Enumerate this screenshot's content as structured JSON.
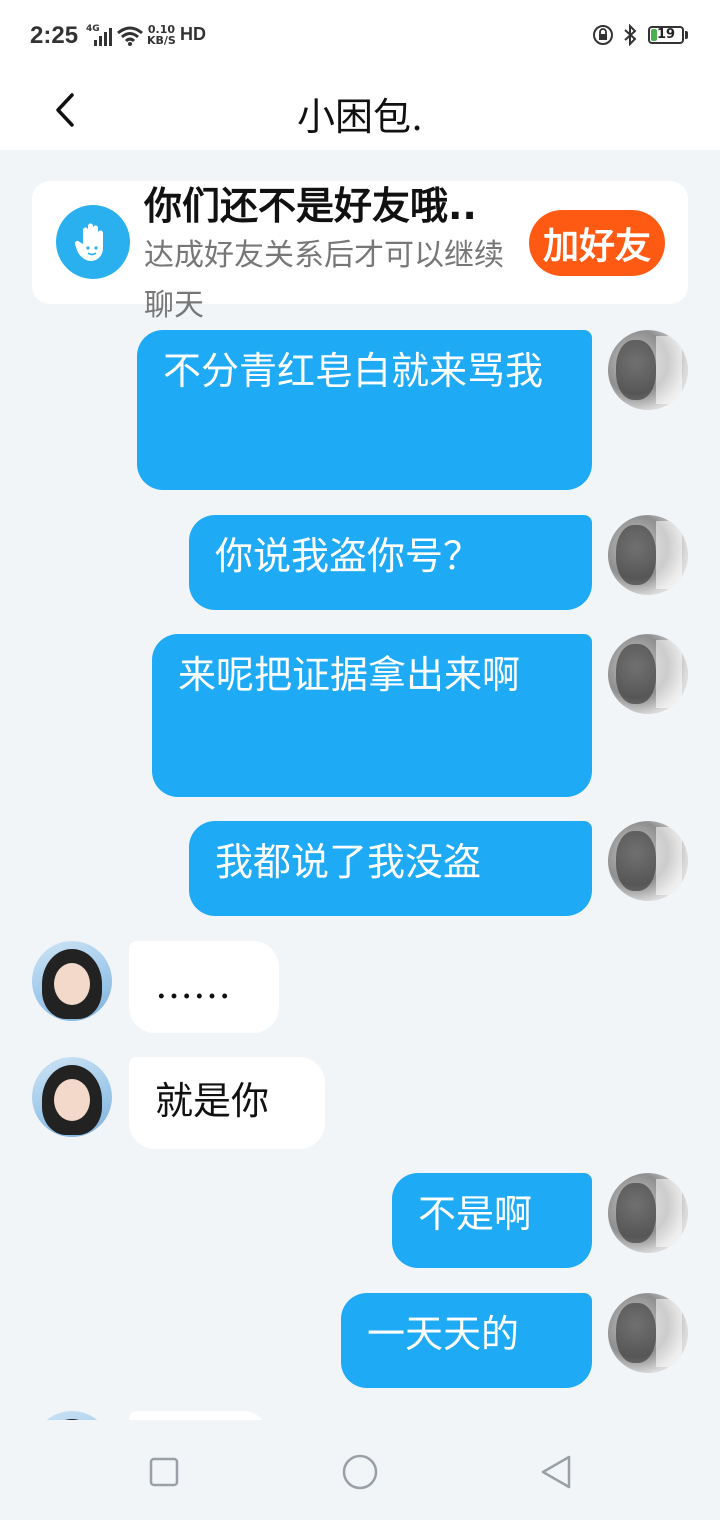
{
  "status": {
    "time": "2:25",
    "network": "4G",
    "speed_value": "0.10",
    "speed_unit": "KB/S",
    "hd": "HD",
    "battery": "19"
  },
  "header": {
    "title": "小困包."
  },
  "banner": {
    "title": "你们还不是好友哦..",
    "subtitle": "达成好友关系后才可以继续聊天",
    "add_button": "加好友"
  },
  "messages": [
    {
      "side": "out",
      "text": "不分青红皂白就来骂我"
    },
    {
      "side": "out",
      "text": "你说我盗你号？"
    },
    {
      "side": "out",
      "text": "来呢把证据拿出来啊"
    },
    {
      "side": "out",
      "text": "我都说了我没盗"
    },
    {
      "side": "in",
      "text": "……"
    },
    {
      "side": "in",
      "text": "就是你"
    },
    {
      "side": "out",
      "text": "不是啊"
    },
    {
      "side": "out",
      "text": "一天天的"
    }
  ],
  "icons": {
    "back": "chevron-left-icon",
    "banner": "hand-wave-icon",
    "nav_recent": "square-icon",
    "nav_home": "circle-icon",
    "nav_back": "triangle-back-icon"
  },
  "colors": {
    "bubble_out": "#1eaaf5",
    "bubble_in": "#ffffff",
    "add_button": "#ff5a14",
    "background": "#f2f5f8"
  }
}
